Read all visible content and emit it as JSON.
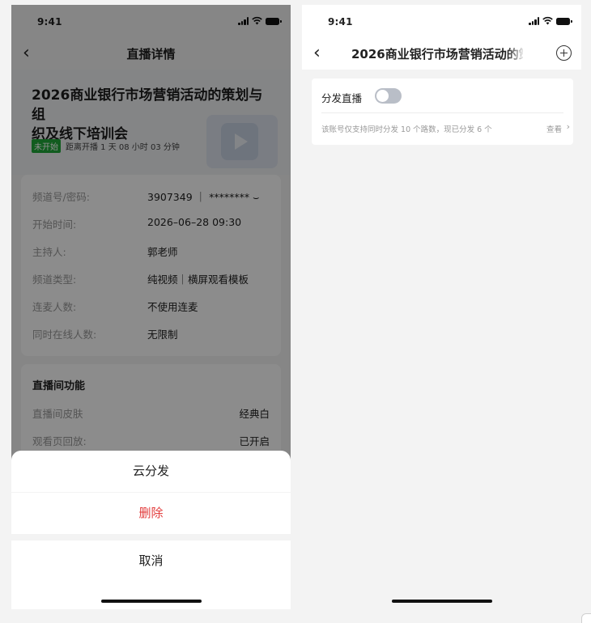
{
  "left": {
    "status_time": "9:41",
    "nav_title": "直播详情",
    "back_glyph": "‹",
    "title_line1": "2026商业银行市场营销活动的策划与组",
    "title_line2": "织及线下培训会",
    "status_tag": "未开始",
    "countdown": "距离开播 1 天 08 小时 03 分钟",
    "info": [
      {
        "label": "频道号/密码:",
        "value": "3907349 ｜ ******** ⌣"
      },
      {
        "label": "开始时间:",
        "value": "2026–06–28 09:30"
      },
      {
        "label": "主持人:",
        "value": "郭老师"
      },
      {
        "label": "频道类型:",
        "value": "纯视频｜横屏观看模板"
      },
      {
        "label": "连麦人数:",
        "value": "不使用连麦"
      },
      {
        "label": "同时在线人数:",
        "value": "无限制"
      }
    ],
    "func_header": "直播间功能",
    "func": [
      {
        "label": "直播间皮肤",
        "value": "经典白"
      },
      {
        "label": "观看页回放:",
        "value": "已开启"
      }
    ],
    "sheet": {
      "cloud_dist": "云分发",
      "delete": "删除",
      "cancel": "取消"
    }
  },
  "right": {
    "status_time": "9:41",
    "back_glyph": "‹",
    "nav_title": "2026商业银行市场营销活动的策",
    "dist_label": "分发直播",
    "toggle_on": false,
    "note": "该账号仅支持同时分发 10 个路数，现已分发 6 个",
    "view": "查看",
    "view_chev": "›"
  },
  "colors": {
    "accent_green": "#20a83a",
    "danger_red": "#e23b3b",
    "toggle_off": "#b9bec7"
  },
  "icons": [
    "signal-icon",
    "wifi-icon",
    "battery-icon",
    "back-icon",
    "play-icon",
    "plus-circle-icon",
    "chevron-right-icon"
  ]
}
